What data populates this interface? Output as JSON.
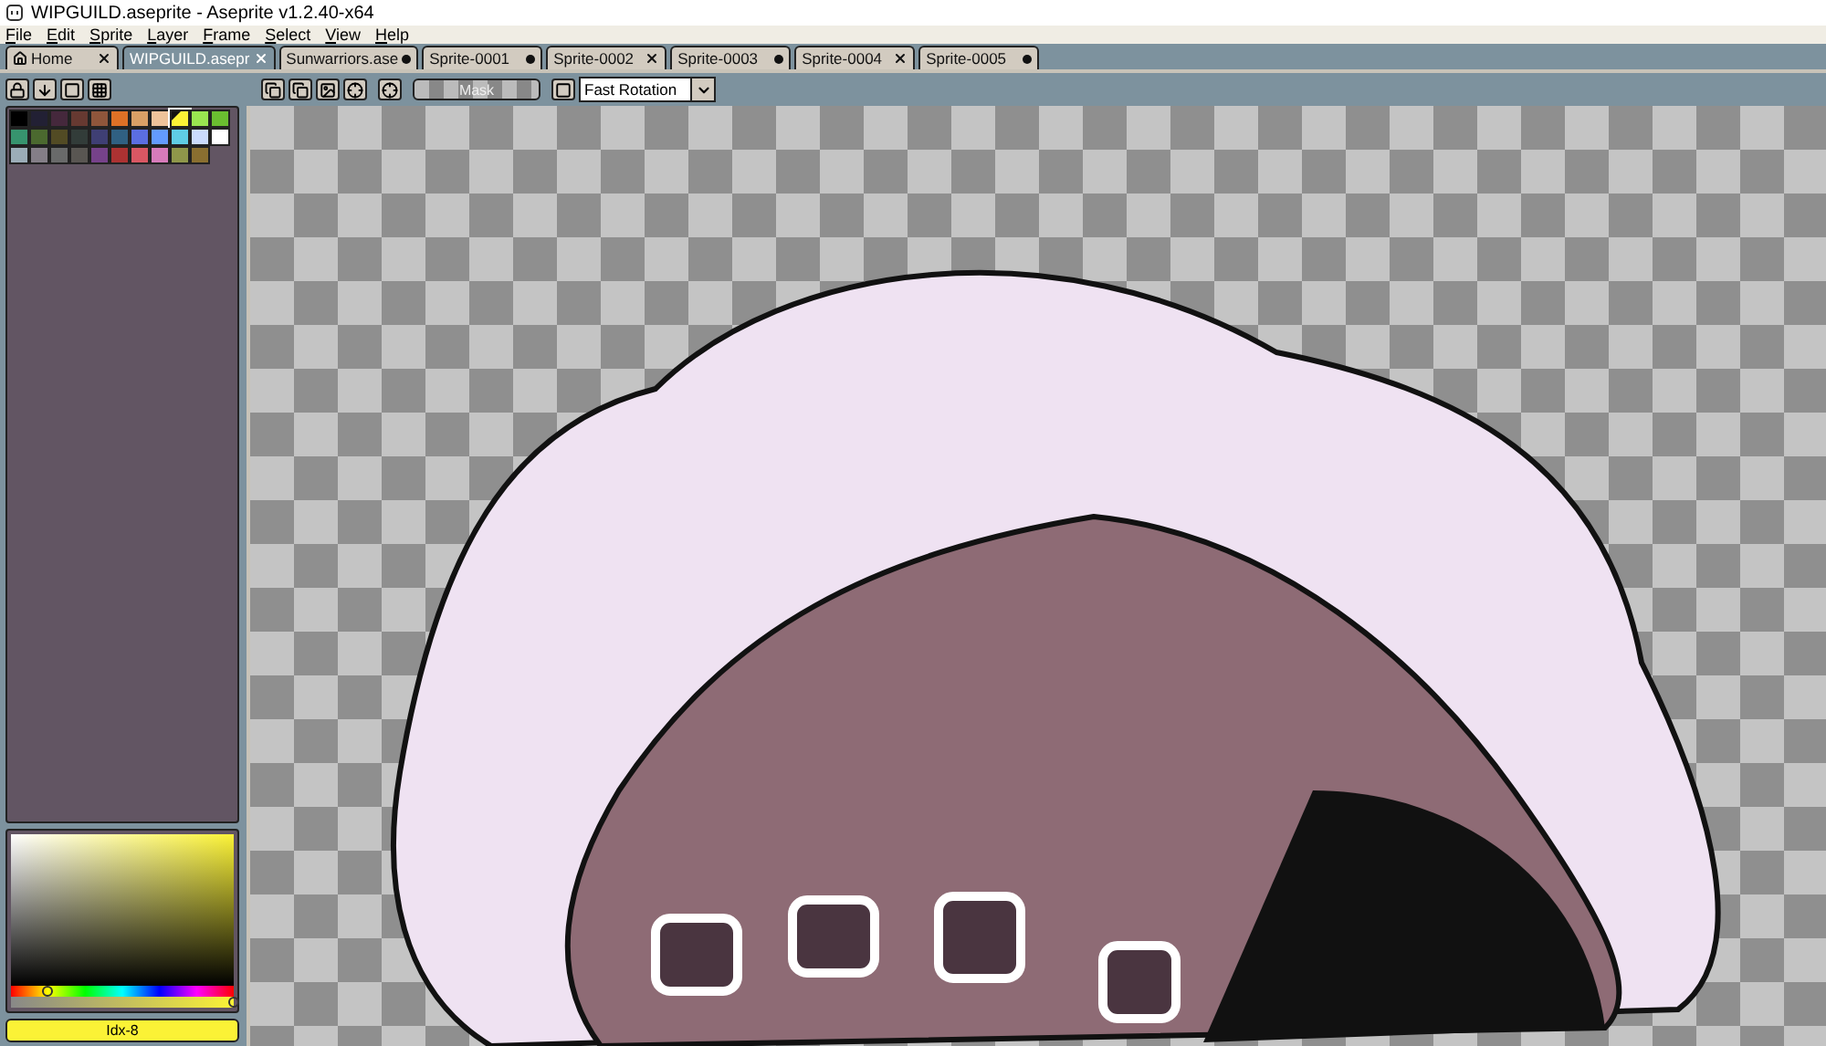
{
  "window": {
    "title": "WIPGUILD.aseprite - Aseprite v1.2.40-x64"
  },
  "menu": [
    "File",
    "Edit",
    "Sprite",
    "Layer",
    "Frame",
    "Select",
    "View",
    "Help"
  ],
  "tabs": [
    {
      "label": "Home",
      "kind": "home",
      "selected": false,
      "modified": false
    },
    {
      "label": "WIPGUILD.asepr",
      "kind": "file",
      "selected": true,
      "modified": false
    },
    {
      "label": "Sunwarriors.ase",
      "kind": "file",
      "selected": false,
      "modified": true
    },
    {
      "label": "Sprite-0001",
      "kind": "file",
      "selected": false,
      "modified": true
    },
    {
      "label": "Sprite-0002",
      "kind": "file",
      "selected": false,
      "modified": false
    },
    {
      "label": "Sprite-0003",
      "kind": "file",
      "selected": false,
      "modified": true
    },
    {
      "label": "Sprite-0004",
      "kind": "file",
      "selected": false,
      "modified": false
    },
    {
      "label": "Sprite-0005",
      "kind": "file",
      "selected": false,
      "modified": true
    }
  ],
  "toolbar": {
    "mask_button": "Mask",
    "rotation_select": "Fast Rotation"
  },
  "palette": [
    {
      "color": "#000000",
      "selected": false
    },
    {
      "color": "#222034",
      "selected": false
    },
    {
      "color": "#45283c",
      "selected": false
    },
    {
      "color": "#663931",
      "selected": false
    },
    {
      "color": "#8f563b",
      "selected": false
    },
    {
      "color": "#df7126",
      "selected": false
    },
    {
      "color": "#d9a066",
      "selected": false
    },
    {
      "color": "#eec39a",
      "selected": false
    },
    {
      "color": "#fbf236",
      "selected": true
    },
    {
      "color": "#99e550",
      "selected": false
    },
    {
      "color": "#6abe30",
      "selected": false
    },
    {
      "color": "#37946e",
      "selected": false
    },
    {
      "color": "#4b692f",
      "selected": false
    },
    {
      "color": "#524b24",
      "selected": false
    },
    {
      "color": "#323c39",
      "selected": false
    },
    {
      "color": "#3f3f74",
      "selected": false
    },
    {
      "color": "#306082",
      "selected": false
    },
    {
      "color": "#5b6ee1",
      "selected": false
    },
    {
      "color": "#639bff",
      "selected": false
    },
    {
      "color": "#5fcde4",
      "selected": false
    },
    {
      "color": "#cbdbfc",
      "selected": false
    },
    {
      "color": "#ffffff",
      "selected": false
    },
    {
      "color": "#9badb7",
      "selected": false
    },
    {
      "color": "#847e87",
      "selected": false
    },
    {
      "color": "#696a6a",
      "selected": false
    },
    {
      "color": "#595652",
      "selected": false
    },
    {
      "color": "#76428a",
      "selected": false
    },
    {
      "color": "#ac3232",
      "selected": false
    },
    {
      "color": "#d95763",
      "selected": false
    },
    {
      "color": "#d77bba",
      "selected": false
    },
    {
      "color": "#8f974a",
      "selected": false
    },
    {
      "color": "#8a6f30",
      "selected": false
    }
  ],
  "color_picker": {
    "color": "#fbf236",
    "label": "Idx-8",
    "hue": {
      "level": 0.16
    },
    "alpha": {
      "level": 1
    }
  }
}
